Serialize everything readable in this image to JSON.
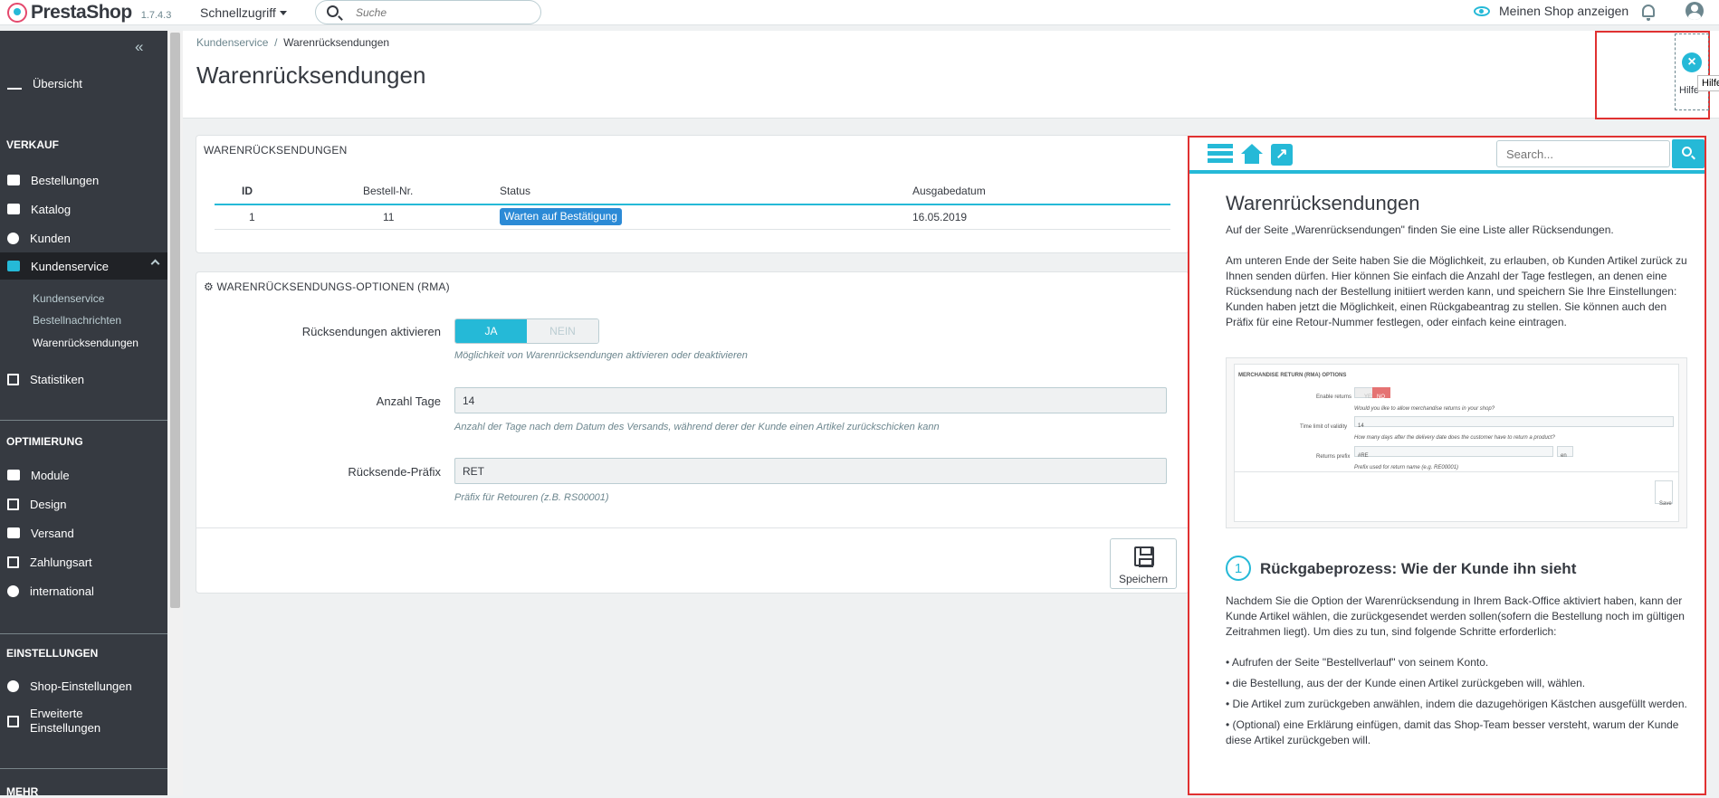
{
  "topbar": {
    "brand": "PrestaShop",
    "version": "1.7.4.3",
    "quick_access": "Schnellzugriff",
    "search_placeholder": "Suche",
    "view_shop": "Meinen Shop anzeigen"
  },
  "sidebar": {
    "overview": "Übersicht",
    "section_sales": "VERKAUF",
    "orders": "Bestellungen",
    "catalog": "Katalog",
    "customers": "Kunden",
    "customer_service": "Kundenservice",
    "sub_customer_service": "Kundenservice",
    "sub_order_messages": "Bestellnachrichten",
    "sub_returns": "Warenrücksendungen",
    "stats": "Statistiken",
    "section_optimization": "OPTIMIERUNG",
    "modules": "Module",
    "design": "Design",
    "shipping": "Versand",
    "payment": "Zahlungsart",
    "international": "international",
    "section_settings": "EINSTELLUNGEN",
    "shop_settings": "Shop-Einstellungen",
    "advanced_1": "Erweiterte",
    "advanced_2": "Einstellungen",
    "section_more": "MEHR"
  },
  "header": {
    "breadcrumb_parent": "Kundenservice",
    "breadcrumb_sep": "/",
    "breadcrumb_current": "Warenrücksendungen",
    "title": "Warenrücksendungen",
    "help_label": "Hilfe",
    "help_tooltip": "Hilfe"
  },
  "returns_panel": {
    "heading": "WARENRÜCKSENDUNGEN",
    "columns": [
      "ID",
      "Bestell-Nr.",
      "Status",
      "Ausgabedatum"
    ],
    "rows": [
      {
        "id": "1",
        "order": "11",
        "status": "Warten auf Bestätigung",
        "date": "16.05.2019"
      }
    ]
  },
  "options_panel": {
    "heading": "WARENRÜCKSENDUNGS-OPTIONEN (RMA)",
    "enable_label": "Rücksendungen aktivieren",
    "toggle_yes": "JA",
    "toggle_no": "NEIN",
    "enable_hint": "Möglichkeit von Warenrücksendungen aktivieren oder deaktivieren",
    "days_label": "Anzahl Tage",
    "days_value": "14",
    "days_hint": "Anzahl der Tage nach dem Datum des Versands, während derer der Kunde einen Artikel zurückschicken kann",
    "prefix_label": "Rücksende-Präfix",
    "prefix_value": "RET",
    "prefix_hint": "Präfix für Retouren (z.B. RS00001)",
    "save_label": "Speichern"
  },
  "help_panel": {
    "search_placeholder": "Search...",
    "title": "Warenrücksendungen",
    "p1": "Auf der Seite „Warenrücksendungen\" finden Sie eine Liste aller Rücksendungen.",
    "p2": "Am unteren Ende der Seite haben Sie die Möglichkeit, zu erlauben, ob Kunden Artikel zurück zu Ihnen senden dürfen. Hier können Sie einfach die Anzahl der Tage festlegen, an denen eine Rücksendung nach der Bestellung initiiert werden kann, und speichern Sie Ihre Einstellungen: Kunden haben jetzt die Möglichkeit, einen Rückgabeantrag zu stellen. Sie können auch den Präfix für eine Retour-Nummer festlegen, oder einfach keine eintragen.",
    "shot": {
      "heading": "MERCHANDISE RETURN (RMA) OPTIONS",
      "enable": "Enable returns",
      "yes": "YES",
      "no": "NO",
      "enable_hint": "Would you like to allow merchandise returns in your shop?",
      "time": "Time limit of validity",
      "time_value": "14",
      "time_hint": "How many days after the delivery date does the customer have to return a product?",
      "prefix": "Returns prefix",
      "prefix_value": "#RE",
      "lang": "en",
      "prefix_hint": "Prefix used for return name (e.g. RE00001)",
      "save": "Save"
    },
    "step_number": "1",
    "h2": "Rückgabeprozess: Wie der Kunde ihn sieht",
    "p3": "Nachdem Sie die Option der Warenrücksendung in Ihrem Back-Office aktiviert haben, kann der Kunde Artikel wählen, die zurückgesendet werden sollen(sofern die Bestellung noch im gültigen Zeitrahmen liegt). Um dies zu tun, sind folgende Schritte erforderlich:",
    "list": [
      "Aufrufen der Seite \"Bestellverlauf\" von seinem Konto.",
      "die Bestellung, aus der der Kunde einen Artikel zurückgeben will, wählen.",
      "Die Artikel zum zurückgeben anwählen, indem die dazugehörigen Kästchen ausgefüllt werden.",
      "(Optional) eine Erklärung einfügen, damit das Shop-Team besser versteht, warum der Kunde diese Artikel zurückgeben will."
    ]
  },
  "colors": {
    "accent": "#25b9d7",
    "sidebar": "#363a41",
    "badge": "#2b8ad6",
    "highlight": "#e03131"
  }
}
